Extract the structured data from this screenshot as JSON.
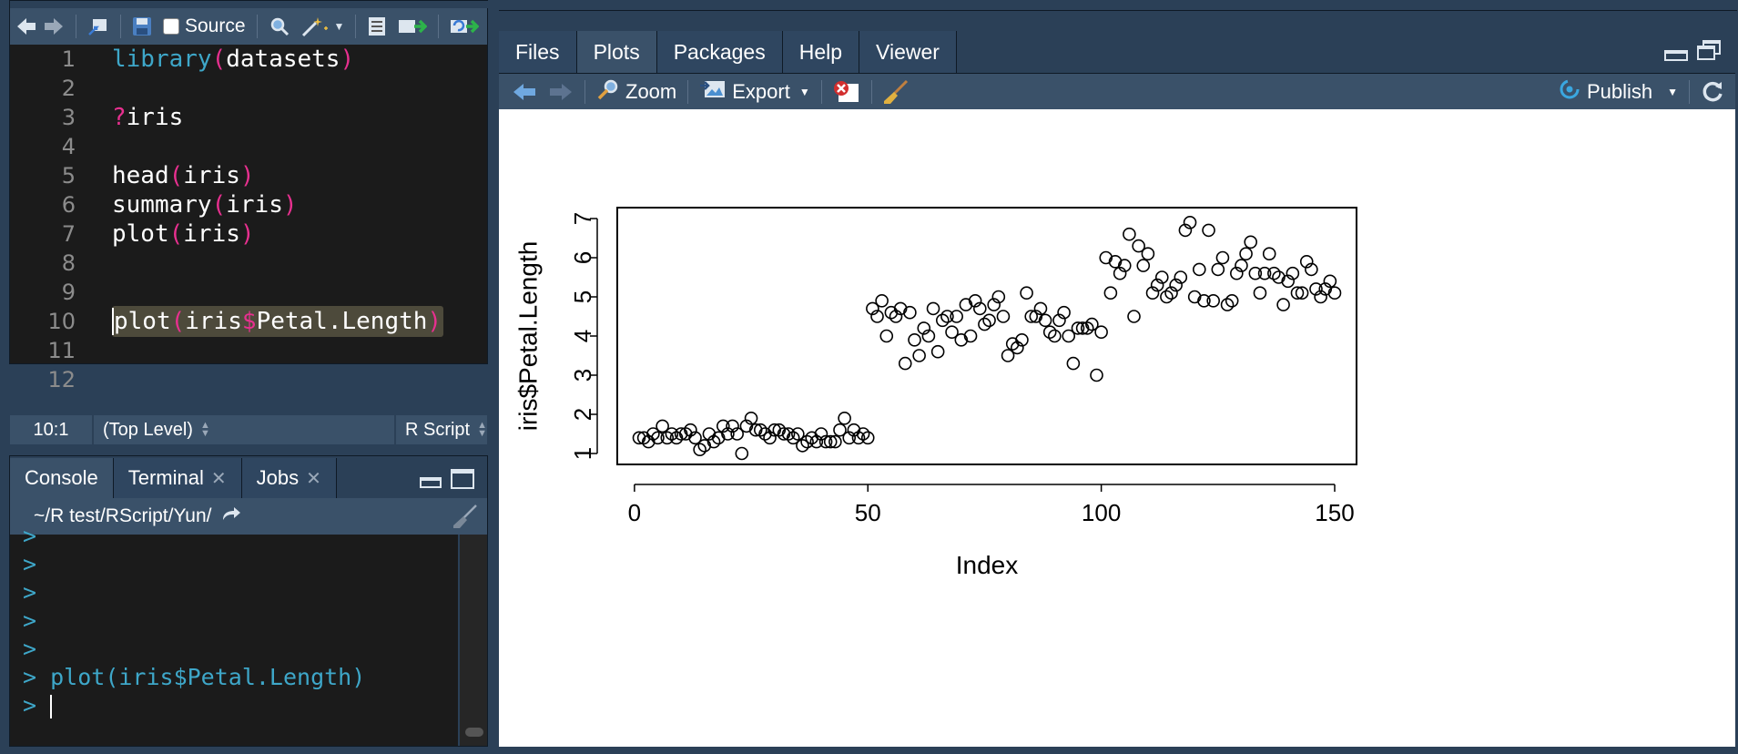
{
  "editor": {
    "toolbar": {
      "source_label": "Source"
    },
    "line_numbers": [
      "1",
      "2",
      "3",
      "4",
      "5",
      "6",
      "7",
      "8",
      "9",
      "10",
      "11",
      "12"
    ],
    "lines": [
      {
        "kind": "call",
        "fn": "library",
        "arg": "datasets"
      },
      {
        "kind": "empty"
      },
      {
        "kind": "help",
        "q": "?",
        "rest": "iris"
      },
      {
        "kind": "empty"
      },
      {
        "kind": "call",
        "fn": "head",
        "arg": "iris"
      },
      {
        "kind": "call",
        "fn": "summary",
        "arg": "iris"
      },
      {
        "kind": "call",
        "fn": "plot",
        "arg": "iris"
      },
      {
        "kind": "empty"
      },
      {
        "kind": "empty"
      },
      {
        "kind": "dollar",
        "fn": "plot",
        "obj": "iris",
        "field": "Petal.Length",
        "highlight": true
      },
      {
        "kind": "empty"
      },
      {
        "kind": "empty"
      }
    ],
    "status": {
      "cursor": "10:1",
      "scope": "(Top Level)",
      "filetype": "R Script"
    }
  },
  "console": {
    "tabs": [
      {
        "label": "Console",
        "active": true,
        "closable": false
      },
      {
        "label": "Terminal",
        "active": false,
        "closable": true
      },
      {
        "label": "Jobs",
        "active": false,
        "closable": true
      }
    ],
    "path": "~/R test/RScript/Yun/",
    "prompt_symbol": ">",
    "lines": [
      "",
      "",
      "",
      "",
      "",
      "plot(iris$Petal.Length)",
      ""
    ]
  },
  "viewer": {
    "tabs": [
      {
        "label": "Files",
        "active": false
      },
      {
        "label": "Plots",
        "active": true
      },
      {
        "label": "Packages",
        "active": false
      },
      {
        "label": "Help",
        "active": false
      },
      {
        "label": "Viewer",
        "active": false
      }
    ],
    "toolbar": {
      "zoom_label": "Zoom",
      "export_label": "Export",
      "publish_label": "Publish"
    }
  },
  "colors": {
    "accent_blue": "#3ea7c9",
    "paren_pink": "#e7308f",
    "toolbar_bg": "#3a5169",
    "pane_border": "#2b4057"
  },
  "chart_data": {
    "type": "scatter",
    "title": "",
    "xlabel": "Index",
    "ylabel": "iris$Petal.Length",
    "xlim": [
      1,
      150
    ],
    "ylim": [
      1,
      7
    ],
    "xticks": [
      0,
      50,
      100,
      150
    ],
    "yticks": [
      1,
      2,
      3,
      4,
      5,
      6,
      7
    ],
    "grid": false,
    "marker": "open-circle",
    "x_index_start": 1,
    "series": [
      {
        "values": [
          1.4,
          1.4,
          1.3,
          1.5,
          1.4,
          1.7,
          1.4,
          1.5,
          1.4,
          1.5,
          1.5,
          1.6,
          1.4,
          1.1,
          1.2,
          1.5,
          1.3,
          1.4,
          1.7,
          1.5,
          1.7,
          1.5,
          1.0,
          1.7,
          1.9,
          1.6,
          1.6,
          1.5,
          1.4,
          1.6,
          1.6,
          1.5,
          1.5,
          1.4,
          1.5,
          1.2,
          1.3,
          1.4,
          1.3,
          1.5,
          1.3,
          1.3,
          1.3,
          1.6,
          1.9,
          1.4,
          1.6,
          1.4,
          1.5,
          1.4,
          4.7,
          4.5,
          4.9,
          4.0,
          4.6,
          4.5,
          4.7,
          3.3,
          4.6,
          3.9,
          3.5,
          4.2,
          4.0,
          4.7,
          3.6,
          4.4,
          4.5,
          4.1,
          4.5,
          3.9,
          4.8,
          4.0,
          4.9,
          4.7,
          4.3,
          4.4,
          4.8,
          5.0,
          4.5,
          3.5,
          3.8,
          3.7,
          3.9,
          5.1,
          4.5,
          4.5,
          4.7,
          4.4,
          4.1,
          4.0,
          4.4,
          4.6,
          4.0,
          3.3,
          4.2,
          4.2,
          4.2,
          4.3,
          3.0,
          4.1,
          6.0,
          5.1,
          5.9,
          5.6,
          5.8,
          6.6,
          4.5,
          6.3,
          5.8,
          6.1,
          5.1,
          5.3,
          5.5,
          5.0,
          5.1,
          5.3,
          5.5,
          6.7,
          6.9,
          5.0,
          5.7,
          4.9,
          6.7,
          4.9,
          5.7,
          6.0,
          4.8,
          4.9,
          5.6,
          5.8,
          6.1,
          6.4,
          5.6,
          5.1,
          5.6,
          6.1,
          5.6,
          5.5,
          4.8,
          5.4,
          5.6,
          5.1,
          5.1,
          5.9,
          5.7,
          5.2,
          5.0,
          5.2,
          5.4,
          5.1
        ]
      }
    ]
  }
}
